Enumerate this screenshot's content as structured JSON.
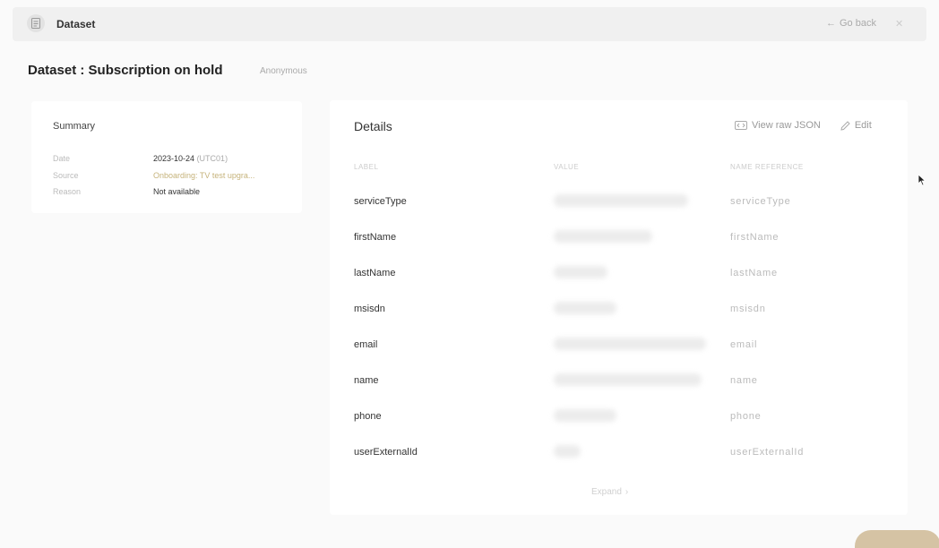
{
  "header": {
    "app_title": "Dataset",
    "go_back_label": "Go back"
  },
  "page": {
    "title": "Dataset : Subscription on hold",
    "subtag": "Anonymous"
  },
  "summary": {
    "title": "Summary",
    "rows": [
      {
        "key": "Date",
        "value": "2023-10-24",
        "value_suffix": "(UTC01)"
      },
      {
        "key": "Source",
        "value": "Onboarding: TV test upgra..."
      },
      {
        "key": "Reason",
        "value": "Not available"
      }
    ]
  },
  "details": {
    "title": "Details",
    "view_json_label": "View raw JSON",
    "edit_label": "Edit",
    "columns": {
      "label": "LABEL",
      "value": "VALUE",
      "reference": "NAME REFERENCE"
    },
    "rows": [
      {
        "label": "serviceType",
        "ref": "serviceType",
        "blur_width": 150
      },
      {
        "label": "firstName",
        "ref": "firstName",
        "blur_width": 110
      },
      {
        "label": "lastName",
        "ref": "lastName",
        "blur_width": 60
      },
      {
        "label": "msisdn",
        "ref": "msisdn",
        "blur_width": 70
      },
      {
        "label": "email",
        "ref": "email",
        "blur_width": 170
      },
      {
        "label": "name",
        "ref": "name",
        "blur_width": 165
      },
      {
        "label": "phone",
        "ref": "phone",
        "blur_width": 70
      },
      {
        "label": "userExternalId",
        "ref": "userExternalId",
        "blur_width": 30
      }
    ],
    "expand_label": "Expand"
  },
  "colors": {
    "accent": "#c6b37b",
    "chat_bubble": "#d5c3a4"
  }
}
